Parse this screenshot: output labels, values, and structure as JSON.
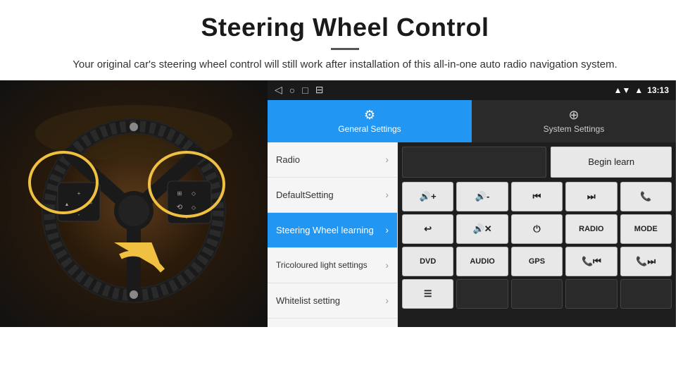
{
  "header": {
    "title": "Steering Wheel Control",
    "divider": true,
    "subtitle": "Your original car's steering wheel control will still work after installation of this all-in-one auto radio navigation system."
  },
  "statusBar": {
    "navBack": "◁",
    "navHome": "○",
    "navRecent": "□",
    "navCast": "⊟",
    "signal": "▼",
    "wifi": "▼",
    "time": "13:13"
  },
  "tabs": [
    {
      "id": "general",
      "label": "General Settings",
      "active": true
    },
    {
      "id": "system",
      "label": "System Settings",
      "active": false
    }
  ],
  "menu": [
    {
      "id": "radio",
      "label": "Radio",
      "active": false
    },
    {
      "id": "default",
      "label": "DefaultSetting",
      "active": false
    },
    {
      "id": "steering",
      "label": "Steering Wheel learning",
      "active": true
    },
    {
      "id": "tricoloured",
      "label": "Tricoloured light settings",
      "active": false
    },
    {
      "id": "whitelist",
      "label": "Whitelist setting",
      "active": false
    }
  ],
  "controls": {
    "beginLearn": "Begin learn",
    "row1": [
      "🔊+",
      "🔊-",
      "⏮",
      "⏭",
      "📞"
    ],
    "row1_labels": [
      "VOL+",
      "VOL-",
      "PREV",
      "NEXT",
      "CALL"
    ],
    "row2_labels": [
      "HANGUP",
      "MUTE",
      "POWER",
      "RADIO",
      "MODE"
    ],
    "row3_labels": [
      "DVD",
      "AUDIO",
      "GPS",
      "TEL+PREV",
      "TEL+NEXT"
    ],
    "row4_labels": [
      "MENU_ICON",
      "",
      "",
      "",
      ""
    ]
  }
}
